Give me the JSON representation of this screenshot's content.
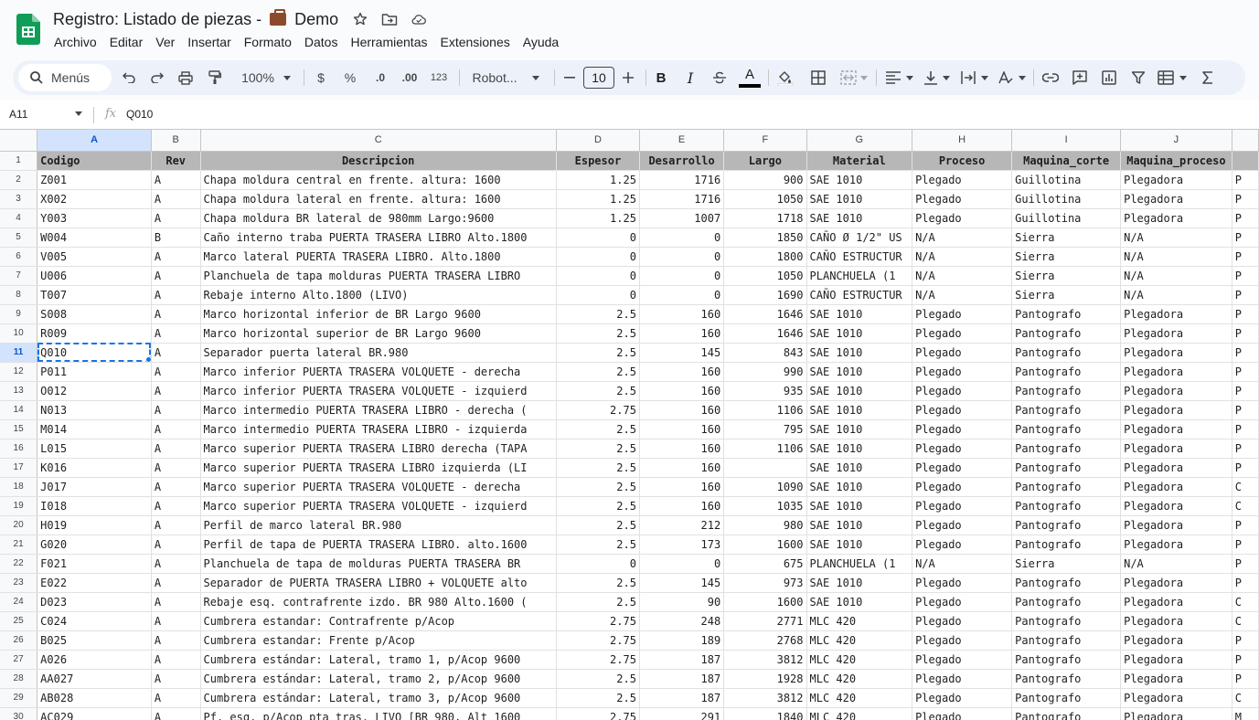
{
  "document": {
    "title_prefix": "Registro: Listado de piezas -",
    "title_suffix": "Demo"
  },
  "menu": [
    "Archivo",
    "Editar",
    "Ver",
    "Insertar",
    "Formato",
    "Datos",
    "Herramientas",
    "Extensiones",
    "Ayuda"
  ],
  "toolbar": {
    "search_label": "Menús",
    "zoom": "100%",
    "currency": "$",
    "percent": "%",
    "decimal_decrease": ".0",
    "decimal_increase": ".00",
    "number_format": "123",
    "font": "Robot...",
    "font_size": "10",
    "bold": "B",
    "italic": "I",
    "text_color": "A"
  },
  "formula_bar": {
    "cell_ref": "A11",
    "fx": "fx",
    "value": "Q010"
  },
  "colors": {
    "header_row": "#b7b7b7",
    "selection": "#1a73e8",
    "selected_header": "#d3e3fd"
  },
  "sheet": {
    "selected_row": 11,
    "selected_col": "A",
    "columns": [
      "A",
      "B",
      "C",
      "D",
      "E",
      "F",
      "G",
      "H",
      "I",
      "J"
    ],
    "header": [
      "Codigo",
      "Rev",
      "Descripcion",
      "Espesor",
      "Desarrollo",
      "Largo",
      "Material",
      "Proceso",
      "Maquina_corte",
      "Maquina_proceso"
    ],
    "rows": [
      [
        "Z001",
        "A",
        "Chapa moldura central en frente. altura: 1600",
        "1.25",
        "1716",
        "900",
        "SAE 1010",
        "Plegado",
        "Guillotina",
        "Plegadora",
        "P"
      ],
      [
        "X002",
        "A",
        "Chapa moldura lateral en frente. altura: 1600",
        "1.25",
        "1716",
        "1050",
        "SAE 1010",
        "Plegado",
        "Guillotina",
        "Plegadora",
        "P"
      ],
      [
        "Y003",
        "A",
        "Chapa moldura BR lateral de 980mm Largo:9600",
        "1.25",
        "1007",
        "1718",
        "SAE 1010",
        "Plegado",
        "Guillotina",
        "Plegadora",
        "P"
      ],
      [
        "W004",
        "B",
        "Caño interno traba PUERTA TRASERA LIBRO Alto.1800",
        "0",
        "0",
        "1850",
        "CAÑO Ø 1/2\" US",
        "N/A",
        "Sierra",
        "N/A",
        "P"
      ],
      [
        "V005",
        "A",
        "Marco lateral PUERTA TRASERA LIBRO. Alto.1800",
        "0",
        "0",
        "1800",
        "CAÑO ESTRUCTUR",
        "N/A",
        "Sierra",
        "N/A",
        "P"
      ],
      [
        "U006",
        "A",
        "Planchuela de tapa molduras PUERTA TRASERA LIBRO",
        "0",
        "0",
        "1050",
        "PLANCHUELA  (1",
        "N/A",
        "Sierra",
        "N/A",
        "P"
      ],
      [
        "T007",
        "A",
        "Rebaje interno Alto.1800 (LIVO)",
        "0",
        "0",
        "1690",
        "CAÑO ESTRUCTUR",
        "N/A",
        "Sierra",
        "N/A",
        "P"
      ],
      [
        "S008",
        "A",
        "Marco horizontal inferior de BR Largo 9600",
        "2.5",
        "160",
        "1646",
        "SAE 1010",
        "Plegado",
        "Pantografo",
        "Plegadora",
        "P"
      ],
      [
        "R009",
        "A",
        "Marco horizontal superior de BR Largo 9600",
        "2.5",
        "160",
        "1646",
        "SAE 1010",
        "Plegado",
        "Pantografo",
        "Plegadora",
        "P"
      ],
      [
        "Q010",
        "A",
        "Separador puerta lateral BR.980",
        "2.5",
        "145",
        "843",
        "SAE 1010",
        "Plegado",
        "Pantografo",
        "Plegadora",
        "P"
      ],
      [
        "P011",
        "A",
        "Marco inferior PUERTA TRASERA VOLQUETE - derecha",
        "2.5",
        "160",
        "990",
        "SAE 1010",
        "Plegado",
        "Pantografo",
        "Plegadora",
        "P"
      ],
      [
        "O012",
        "A",
        "Marco inferior PUERTA TRASERA VOLQUETE - izquierd",
        "2.5",
        "160",
        "935",
        "SAE 1010",
        "Plegado",
        "Pantografo",
        "Plegadora",
        "P"
      ],
      [
        "N013",
        "A",
        "Marco intermedio PUERTA TRASERA LIBRO - derecha (",
        "2.75",
        "160",
        "1106",
        "SAE 1010",
        "Plegado",
        "Pantografo",
        "Plegadora",
        "P"
      ],
      [
        "M014",
        "A",
        "Marco intermedio PUERTA TRASERA LIBRO - izquierda",
        "2.5",
        "160",
        "795",
        "SAE 1010",
        "Plegado",
        "Pantografo",
        "Plegadora",
        "P"
      ],
      [
        "L015",
        "A",
        "Marco superior PUERTA TRASERA LIBRO derecha (TAPA",
        "2.5",
        "160",
        "1106",
        "SAE 1010",
        "Plegado",
        "Pantografo",
        "Plegadora",
        "P"
      ],
      [
        "K016",
        "A",
        "Marco superior PUERTA TRASERA LIBRO izquierda (LI",
        "2.5",
        "160",
        "",
        "SAE 1010",
        "Plegado",
        "Pantografo",
        "Plegadora",
        "P"
      ],
      [
        "J017",
        "A",
        "Marco superior PUERTA TRASERA VOLQUETE - derecha",
        "2.5",
        "160",
        "1090",
        "SAE 1010",
        "Plegado",
        "Pantografo",
        "Plegadora",
        "C"
      ],
      [
        "I018",
        "A",
        "Marco superior PUERTA TRASERA VOLQUETE - izquierd",
        "2.5",
        "160",
        "1035",
        "SAE 1010",
        "Plegado",
        "Pantografo",
        "Plegadora",
        "C"
      ],
      [
        "H019",
        "A",
        "Perfil de marco lateral BR.980",
        "2.5",
        "212",
        "980",
        "SAE 1010",
        "Plegado",
        "Pantografo",
        "Plegadora",
        "P"
      ],
      [
        "G020",
        "A",
        "Perfil de tapa de PUERTA TRASERA LIBRO. alto.1600",
        "2.5",
        "173",
        "1600",
        "SAE 1010",
        "Plegado",
        "Pantografo",
        "Plegadora",
        "P"
      ],
      [
        "F021",
        "A",
        "Planchuela de tapa de molduras PUERTA TRASERA BR",
        "0",
        "0",
        "675",
        "PLANCHUELA  (1",
        "N/A",
        "Sierra",
        "N/A",
        "P"
      ],
      [
        "E022",
        "A",
        "Separador de PUERTA TRASERA LIBRO + VOLQUETE alto",
        "2.5",
        "145",
        "973",
        "SAE 1010",
        "Plegado",
        "Pantografo",
        "Plegadora",
        "P"
      ],
      [
        "D023",
        "A",
        "Rebaje esq. contrafrente izdo. BR 980 Alto.1600 (",
        "2.5",
        "90",
        "1600",
        "SAE 1010",
        "Plegado",
        "Pantografo",
        "Plegadora",
        "C"
      ],
      [
        "C024",
        "A",
        "Cumbrera estandar: Contrafrente p/Acop",
        "2.75",
        "248",
        "2771",
        "MLC 420",
        "Plegado",
        "Pantografo",
        "Plegadora",
        "C"
      ],
      [
        "B025",
        "A",
        "Cumbrera estandar: Frente p/Acop",
        "2.75",
        "189",
        "2768",
        "MLC 420",
        "Plegado",
        "Pantografo",
        "Plegadora",
        "P"
      ],
      [
        "A026",
        "A",
        "Cumbrera estándar: Lateral, tramo 1, p/Acop 9600",
        "2.75",
        "187",
        "3812",
        "MLC 420",
        "Plegado",
        "Pantografo",
        "Plegadora",
        "P"
      ],
      [
        "AA027",
        "A",
        "Cumbrera estándar: Lateral, tramo 2, p/Acop 9600",
        "2.5",
        "187",
        "1928",
        "MLC 420",
        "Plegado",
        "Pantografo",
        "Plegadora",
        "P"
      ],
      [
        "AB028",
        "A",
        "Cumbrera estándar: Lateral, tramo 3, p/Acop 9600",
        "2.5",
        "187",
        "3812",
        "MLC 420",
        "Plegado",
        "Pantografo",
        "Plegadora",
        "C"
      ],
      [
        "AC029",
        "A",
        "Pf. esq. p/Acop pta tras. LIVO [BR 980, Alt 1600",
        "2.75",
        "291",
        "1840",
        "MLC 420",
        "Plegado",
        "Pantografo",
        "Plegadora",
        "M"
      ]
    ]
  }
}
